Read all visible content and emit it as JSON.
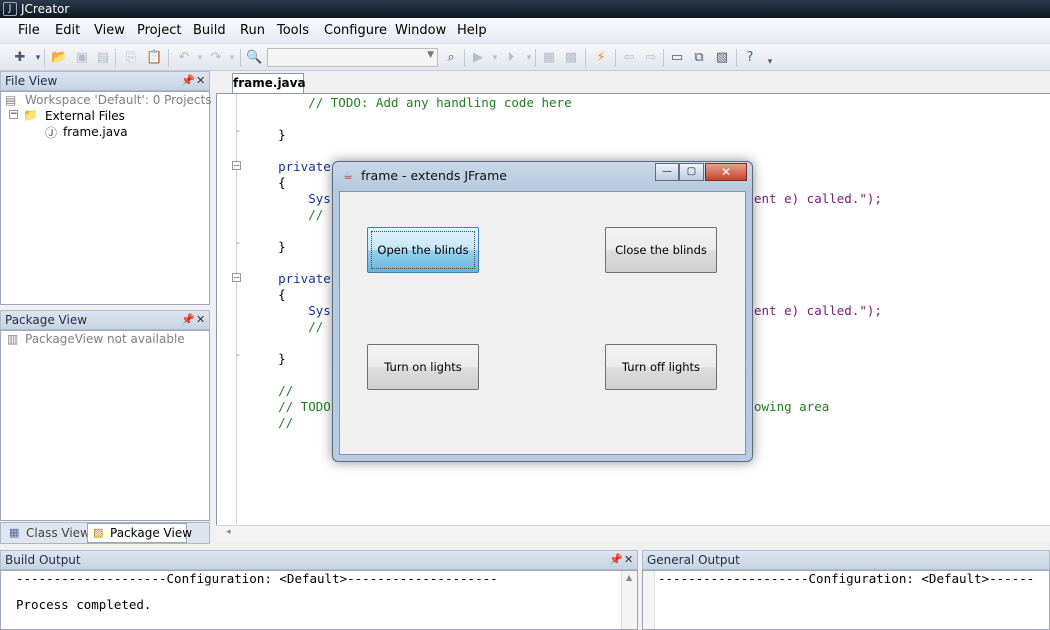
{
  "app": {
    "title": "JCreator"
  },
  "menu": [
    "File",
    "Edit",
    "View",
    "Project",
    "Build",
    "Run",
    "Tools",
    "Configure",
    "Window",
    "Help"
  ],
  "file_view": {
    "title": "File View",
    "tree": {
      "workspace": "Workspace 'Default': 0 Projects",
      "folder": "External Files",
      "file": "frame.java"
    }
  },
  "package_view": {
    "title": "Package View",
    "message": "PackageView not available"
  },
  "left_tabs": {
    "class_view": "Class View",
    "package_view": "Package View"
  },
  "editor": {
    "tab": "frame.java",
    "lines": {
      "l1": "        // TODO: Add any handling code here",
      "l2": "    }",
      "l3": "    private",
      "l4": "    {",
      "l5": "        Sys",
      "l5b": "ent e) called.\");",
      "l6": "        //",
      "l7": "    }",
      "l8": "    private",
      "l9": "    {",
      "l10": "        Sys",
      "l10b": "ent e) called.\");",
      "l11": "        //",
      "l12": "    }",
      "l13": "    //",
      "l14": "    // TODO",
      "l14b": "owing area",
      "l15": "    //"
    }
  },
  "dialog": {
    "title": "frame - extends JFrame",
    "buttons": {
      "open_blinds": "Open the blinds",
      "close_blinds": "Close the blinds",
      "lights_on": "Turn on lights",
      "lights_off": "Turn off lights"
    }
  },
  "build_output": {
    "title": "Build Output",
    "line1": "--------------------Configuration: <Default>--------------------",
    "line2": "Process completed."
  },
  "general_output": {
    "title": "General Output",
    "line1": "--------------------Configuration: <Default>------"
  },
  "icons": {
    "app": "jcreator-app-icon",
    "java": "java-cup-icon"
  },
  "colors": {
    "comment": "#208020",
    "keyword": "#1a2fa0",
    "string": "#7a1a7a"
  }
}
